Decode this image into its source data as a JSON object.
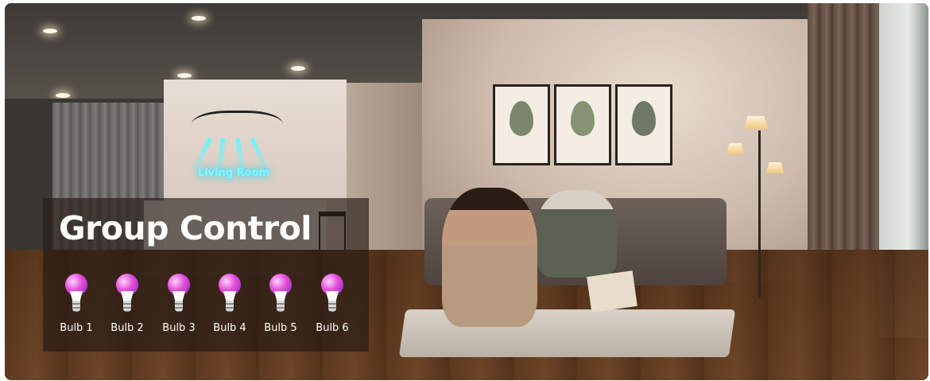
{
  "sign": {
    "neon_text": "Living Room"
  },
  "overlay": {
    "title": "Group Control",
    "bulbs": [
      {
        "label": "Bulb 1"
      },
      {
        "label": "Bulb 2"
      },
      {
        "label": "Bulb 3"
      },
      {
        "label": "Bulb 4"
      },
      {
        "label": "Bulb 5"
      },
      {
        "label": "Bulb 6"
      }
    ]
  },
  "colors": {
    "bulb_glow": "#e24bd8",
    "neon": "#7ff6ff",
    "panel": "#261c16"
  },
  "icons": [
    "bulb-icon"
  ]
}
